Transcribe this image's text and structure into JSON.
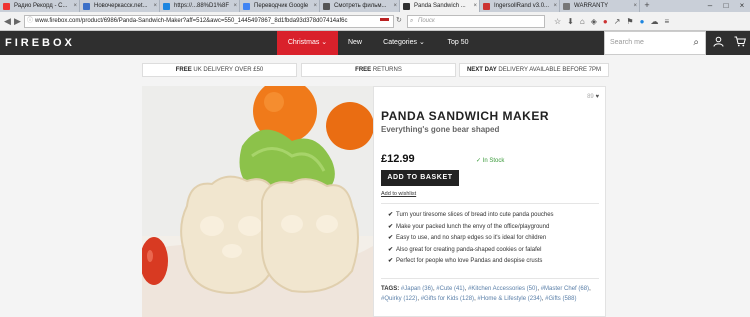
{
  "browser": {
    "tabs": [
      {
        "label": "Радио Рекорд - С...",
        "fav": "#e33"
      },
      {
        "label": "Новочеркасск.net...",
        "fav": "#3a6fc8"
      },
      {
        "label": "https://...88%D1%8F",
        "fav": "#1d86e0"
      },
      {
        "label": "Переводчик Google",
        "fav": "#4285f4"
      },
      {
        "label": "Смотреть фильм...",
        "fav": "#555"
      },
      {
        "label": "Panda Sandwich ...",
        "fav": "#2f2f2f",
        "active": true
      },
      {
        "label": "IngersollRand v3.0...",
        "fav": "#c33"
      },
      {
        "label": "WARRANTY",
        "fav": "#777"
      }
    ],
    "new_tab": "+",
    "url": "www.firebox.com/product/6986/Panda-Sandwich-Maker?aff=512&awc=550_1445497867_8d1fbda93d378d07414af6c",
    "search_placeholder": "Поиск",
    "tool_icons": [
      "star-icon",
      "download-icon",
      "home-icon",
      "menu-icon"
    ]
  },
  "site": {
    "logo": "FIREBOX",
    "nav": [
      {
        "label": "Christmas ⌄",
        "highlight": true
      },
      {
        "label": "New"
      },
      {
        "label": "Categories ⌄"
      },
      {
        "label": "Top 50"
      }
    ],
    "search_placeholder": "Search me",
    "accent": "#d9212b"
  },
  "strips": [
    {
      "bold": "FREE",
      "text": " UK DELIVERY OVER £50"
    },
    {
      "bold": "FREE",
      "text": " RETURNS"
    },
    {
      "bold": "NEXT DAY",
      "text": " DELIVERY AVAILABLE BEFORE 7PM"
    }
  ],
  "product": {
    "count": "89",
    "title": "PANDA SANDWICH MAKER",
    "subtitle": "Everything's gone bear shaped",
    "price": "£12.99",
    "stock": "✓ In Stock",
    "add_to_basket": "ADD TO BASKET",
    "wishlist": "Add to wishlist",
    "features": [
      "Turn your tiresome slices of bread into cute panda pouches",
      "Make your packed lunch the envy of the office/playground",
      "Easy to use, and no sharp edges so it's ideal for children",
      "Also great for creating panda-shaped cookies or falafel",
      "Perfect for people who love Pandas and despise crusts"
    ],
    "tags_label": "TAGS:",
    "tags": [
      "#Japan (36)",
      "#Cute (41)",
      "#Kitchen Accessories (50)",
      "#Master Chef (68)",
      "#Quirky (122)",
      "#Gifts for Kids (128)",
      "#Home & Lifestyle (234)",
      "#Gifts (588)"
    ]
  }
}
